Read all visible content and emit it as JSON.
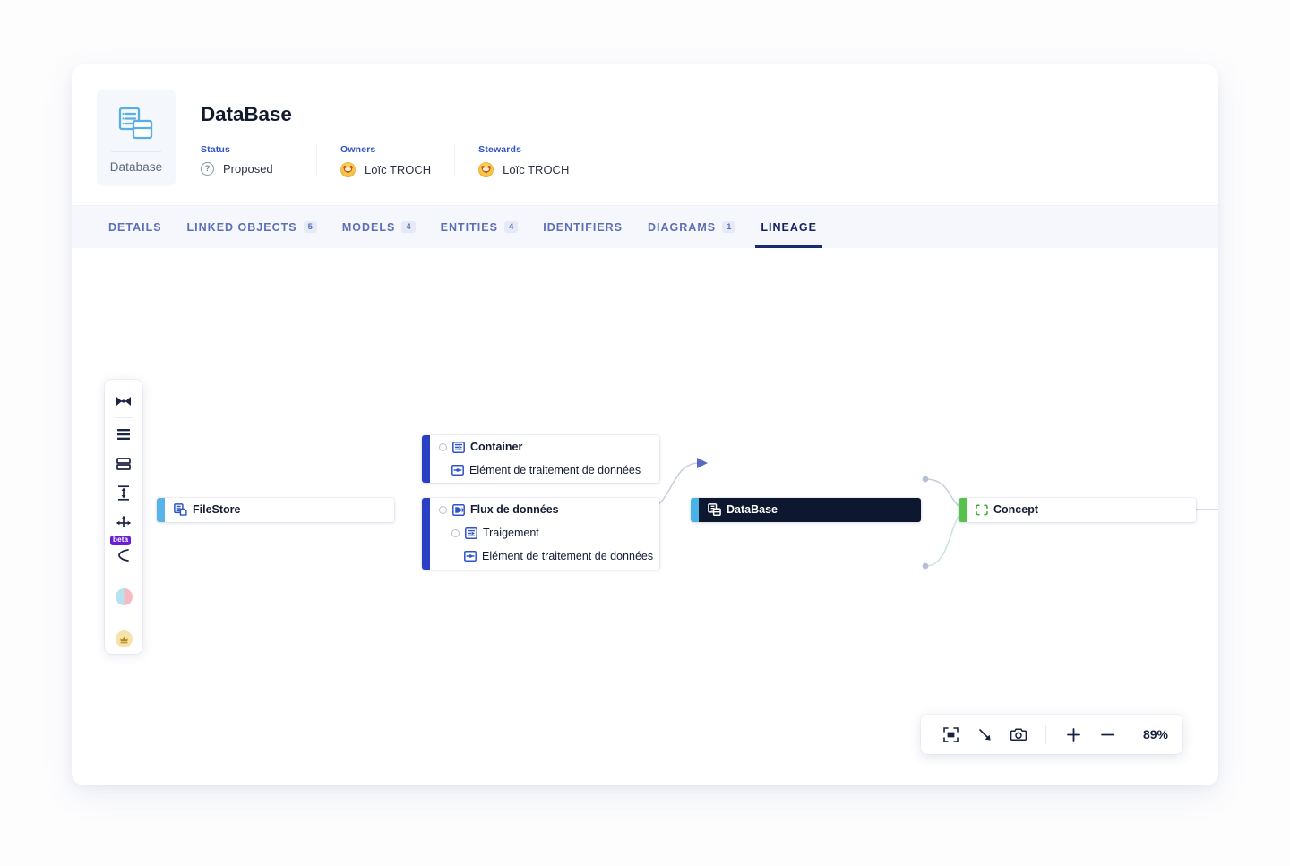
{
  "header": {
    "type_badge": {
      "icon": "database-icon",
      "label": "Database"
    },
    "title": "DataBase",
    "meta": [
      {
        "label": "Status",
        "icon": "question-circle-icon",
        "value": "Proposed"
      },
      {
        "label": "Owners",
        "icon": "user-avatar",
        "value": "Loïc TROCH"
      },
      {
        "label": "Stewards",
        "icon": "user-avatar",
        "value": "Loïc TROCH"
      }
    ]
  },
  "tabs": [
    {
      "label": "DETAILS",
      "count": "",
      "active": false
    },
    {
      "label": "LINKED OBJECTS",
      "count": "5",
      "active": false
    },
    {
      "label": "MODELS",
      "count": "4",
      "active": false
    },
    {
      "label": "ENTITIES",
      "count": "4",
      "active": false
    },
    {
      "label": "IDENTIFIERS",
      "count": "",
      "active": false
    },
    {
      "label": "DIAGRAMS",
      "count": "1",
      "active": false
    },
    {
      "label": "LINEAGE",
      "count": "",
      "active": true
    }
  ],
  "toolbar": {
    "items": [
      {
        "name": "collapse-all-icon",
        "label": "Collapse all"
      },
      {
        "name": "list-layout-icon",
        "label": "List layout"
      },
      {
        "name": "grid-layout-icon",
        "label": "Grid layout"
      },
      {
        "name": "vertical-fit-icon",
        "label": "Vertical fit"
      },
      {
        "name": "expand-impact-icon",
        "label": "Expand impact"
      },
      {
        "name": "branch-icon",
        "label": "Branch",
        "badge": "beta"
      },
      {
        "name": "color-legend-icon",
        "label": "Color legend"
      },
      {
        "name": "quality-crown-icon",
        "label": "Quality"
      }
    ]
  },
  "graph": {
    "nodes": [
      {
        "id": "filestore",
        "accent": "#58b4e8",
        "selected": false,
        "rows": [
          {
            "indent": 1,
            "icon": "filestore-icon",
            "label": "FileStore",
            "bold": true,
            "toggle": false
          }
        ]
      },
      {
        "id": "container",
        "accent": "#2b3fc4",
        "selected": false,
        "rows": [
          {
            "indent": 1,
            "icon": "container-icon",
            "label": "Container",
            "bold": true,
            "toggle": true
          },
          {
            "indent": 2,
            "icon": "data-processing-icon",
            "label": "Elément de traitement de données",
            "bold": false,
            "toggle": false
          }
        ]
      },
      {
        "id": "flux",
        "accent": "#2b3fc4",
        "selected": false,
        "rows": [
          {
            "indent": 1,
            "icon": "dataflow-icon",
            "label": "Flux de données",
            "bold": true,
            "toggle": true
          },
          {
            "indent": 2,
            "icon": "container-icon",
            "label": "Traigement",
            "bold": false,
            "toggle": true
          },
          {
            "indent": 3,
            "icon": "data-processing-icon",
            "label": "Elément de traitement de données",
            "bold": false,
            "toggle": false
          }
        ]
      },
      {
        "id": "database",
        "accent": "#49b3e8",
        "selected": true,
        "rows": [
          {
            "indent": 1,
            "icon": "database-node-icon",
            "label": "DataBase",
            "bold": true,
            "toggle": false
          }
        ]
      },
      {
        "id": "concept",
        "accent": "#57c24a",
        "selected": false,
        "rows": [
          {
            "indent": 1,
            "icon": "concept-icon",
            "label": "Concept",
            "bold": true,
            "toggle": false
          }
        ]
      }
    ]
  },
  "zoom_controls": {
    "fit_icon": "fit-to-screen-icon",
    "resize_icon": "resize-diagonal-icon",
    "snapshot_icon": "camera-icon",
    "zoom_in": "+",
    "zoom_out": "−",
    "level": "89%"
  },
  "colors": {
    "accent_blue": "#2f53c8",
    "tab_active": "#16215c",
    "selected_node_bg": "#0e1730",
    "edge": "#c3cbe0",
    "canvas_bg": "#ffffff"
  }
}
